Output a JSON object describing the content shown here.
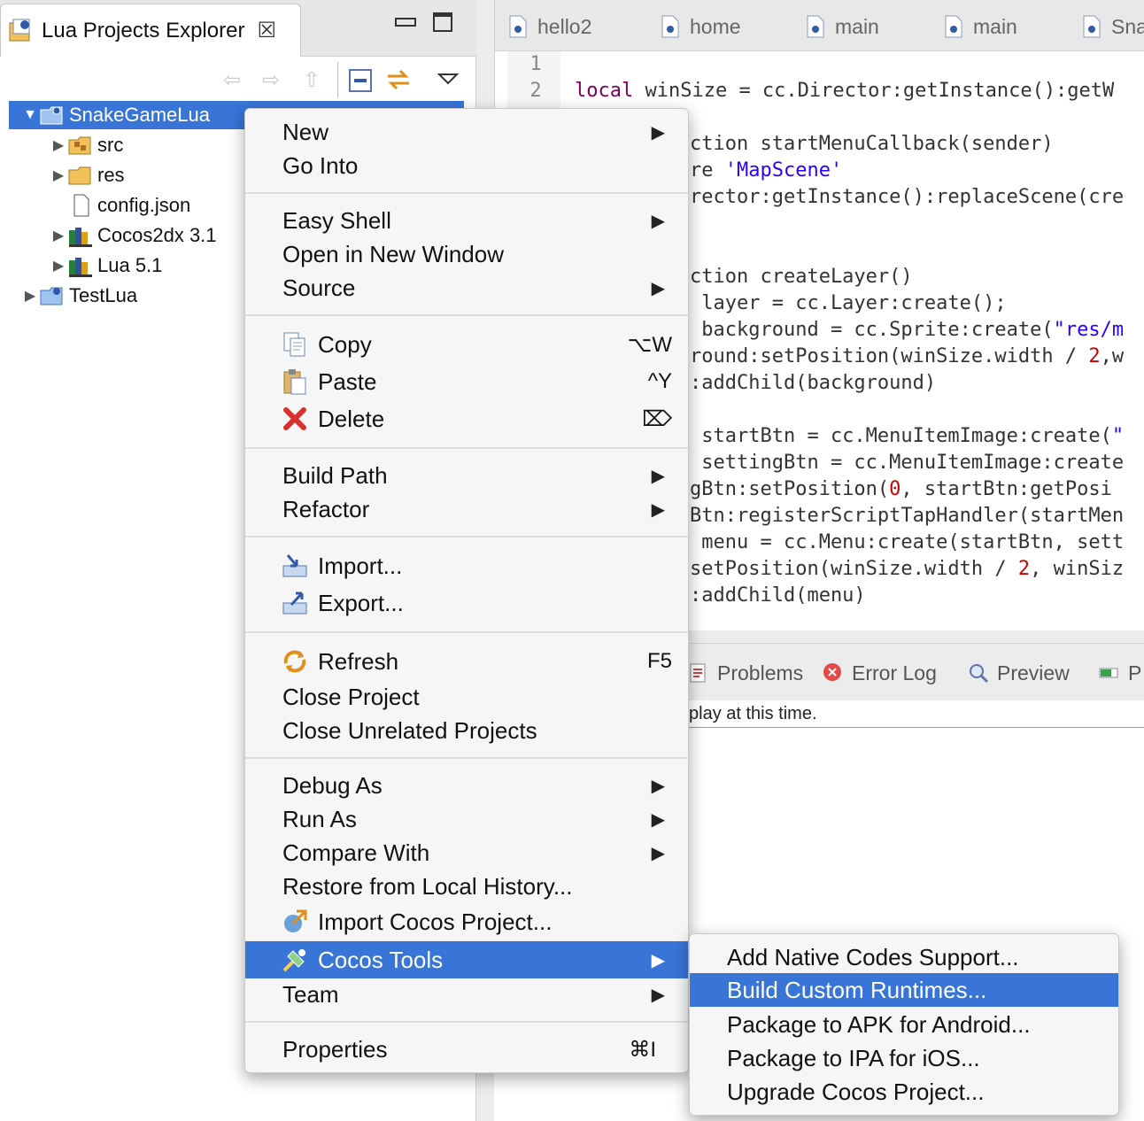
{
  "explorer": {
    "title": "Lua Projects Explorer",
    "close_glyph": "☒",
    "tree": [
      {
        "label": "SnakeGameLua",
        "selected": true,
        "expanded": true
      },
      {
        "label": "src"
      },
      {
        "label": "res"
      },
      {
        "label": "config.json"
      },
      {
        "label": "Cocos2dx 3.1"
      },
      {
        "label": "Lua 5.1"
      },
      {
        "label": "TestLua"
      }
    ]
  },
  "editor": {
    "tabs": [
      "hello2",
      "home",
      "main",
      "main",
      "Sna"
    ],
    "line_numbers": [
      "1",
      "2"
    ],
    "code": {
      "line2_kw": "local",
      "line2_rest": " winSize = cc.Director:getInstance():getW",
      "l_a": "ction startMenuCallback(sender)",
      "l_b1": "re ",
      "l_b2": "'MapScene'",
      "l_c": "rector:getInstance():replaceScene(cre",
      "l_d": "ction createLayer()",
      "l_e": " layer = cc.Layer:create();",
      "l_f1": " background = cc.Sprite:create(",
      "l_f2": "\"res/m",
      "l_g1": "round:setPosition(winSize.width / ",
      "l_g2": "2",
      "l_g3": ",w",
      "l_h": ":addChild(background)",
      "l_i1": " startBtn = cc.MenuItemImage:create(",
      "l_i2": "\"",
      "l_j": " settingBtn = cc.MenuItemImage:create",
      "l_k1": "gBtn:setPosition(",
      "l_k2": "0",
      "l_k3": ", startBtn:getPosi",
      "l_l": "Btn:registerScriptTapHandler(startMen",
      "l_m": " menu = cc.Menu:create(startBtn, sett",
      "l_n1": "setPosition(winSize.width / ",
      "l_n2": "2",
      "l_n3": ", winSiz",
      "l_o": ":addChild(menu)"
    }
  },
  "bottom": {
    "tabs": [
      "Problems",
      "Error Log",
      "Preview",
      "P"
    ],
    "message": "play at this time."
  },
  "context_menu": {
    "items": {
      "new": "New",
      "go_into": "Go Into",
      "easy_shell": "Easy Shell",
      "open_new_window": "Open in New Window",
      "source": "Source",
      "copy": "Copy",
      "copy_shortcut": "⌥W",
      "paste": "Paste",
      "paste_shortcut": "^Y",
      "delete": "Delete",
      "delete_shortcut": "⌦",
      "build_path": "Build Path",
      "refactor": "Refactor",
      "import": "Import...",
      "export": "Export...",
      "refresh": "Refresh",
      "refresh_shortcut": "F5",
      "close_project": "Close Project",
      "close_unrelated": "Close Unrelated Projects",
      "debug_as": "Debug As",
      "run_as": "Run As",
      "compare_with": "Compare With",
      "restore_history": "Restore from Local History...",
      "import_cocos": "Import Cocos Project...",
      "cocos_tools": "Cocos Tools",
      "team": "Team",
      "properties": "Properties",
      "properties_shortcut": "⌘I"
    },
    "submenu": [
      "Add Native Codes Support...",
      "Build Custom Runtimes...",
      "Package to APK for Android...",
      "Package to IPA for iOS...",
      "Upgrade Cocos Project..."
    ],
    "submenu_selected": "Build Custom Runtimes..."
  },
  "colors": {
    "selection": "#3875d7",
    "keyword": "#7f0055",
    "string": "#2a00ff",
    "number": "#cc0000"
  }
}
